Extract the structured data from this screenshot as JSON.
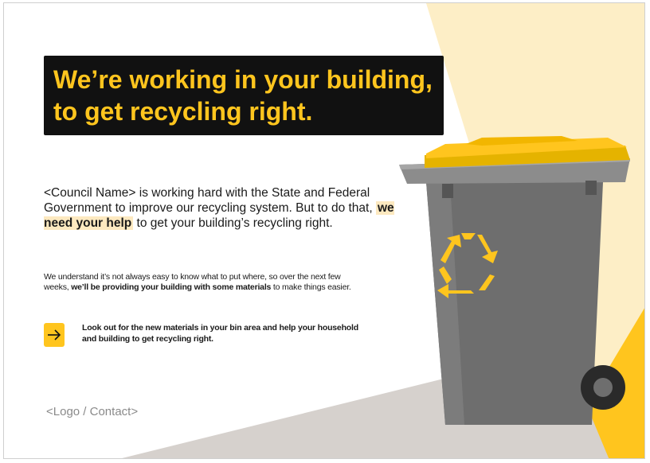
{
  "headline": {
    "line1": "We’re working in your building,",
    "line2": "to get recycling right."
  },
  "intro": {
    "part1": "<Council Name> is working hard with the State and Federal Government to improve our recycling system. But to do that, ",
    "highlight": "we need your help",
    "part2": " to get your building’s recycling right."
  },
  "details": {
    "part1": "We understand it’s not always easy to know what to put where, so over the next few weeks, ",
    "bold": "we’ll be providing your building with some materials",
    "part2": " to make things easier."
  },
  "callout": {
    "icon": "arrow-right-icon",
    "text": "Look out for the new materials in your bin area  and help your household and building to get recycling right."
  },
  "footer": {
    "logo_contact": "<Logo / Contact>"
  },
  "colors": {
    "accent_yellow": "#ffc51e",
    "pale_yellow": "#fdeec6",
    "headline_bg": "#111111",
    "bin_grey": "#6e6e6e",
    "floor_grey": "#d6d1cd"
  }
}
